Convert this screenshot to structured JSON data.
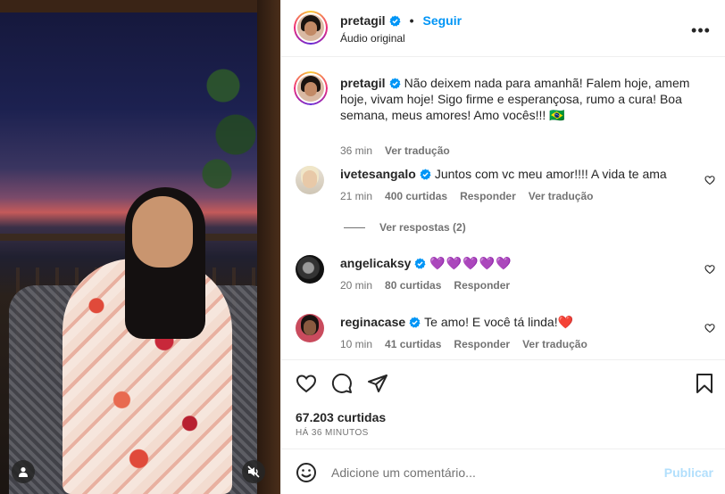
{
  "post": {
    "author": "pretagil",
    "follow_label": "Seguir",
    "dot": "•",
    "audio": "Áudio original",
    "more_label": "•••"
  },
  "caption": {
    "username": "pretagil",
    "text": "Não deixem nada para amanhã! Falem hoje, amem hoje, vivam hoje! Sigo firme e esperançosa, rumo a cura! Boa semana, meus amores! Amo vocês!!! 🇧🇷",
    "time": "36 min",
    "translate": "Ver tradução"
  },
  "comments": [
    {
      "username": "ivetesangalo",
      "text": "Juntos com vc meu amor!!!! A vida te ama",
      "time": "21 min",
      "likes": "400 curtidas",
      "reply": "Responder",
      "translate": "Ver tradução",
      "view_replies": "Ver respostas (2)"
    },
    {
      "username": "angelicaksy",
      "text": "💜💜💜💜💜",
      "time": "20 min",
      "likes": "80 curtidas",
      "reply": "Responder"
    },
    {
      "username": "reginacase",
      "text": "Te amo! E você tá linda!",
      "emoji": "❤️",
      "time": "10 min",
      "likes": "41 curtidas",
      "reply": "Responder",
      "translate": "Ver tradução"
    }
  ],
  "footer": {
    "likes": "67.203 curtidas",
    "time": "HÁ 36 MINUTOS",
    "comment_placeholder": "Adicione um comentário...",
    "publish": "Publicar"
  },
  "icons": {
    "accent": "#0095f6",
    "verified": "#0095f6",
    "purple": "#a24cf0",
    "red": "#e0245e"
  }
}
